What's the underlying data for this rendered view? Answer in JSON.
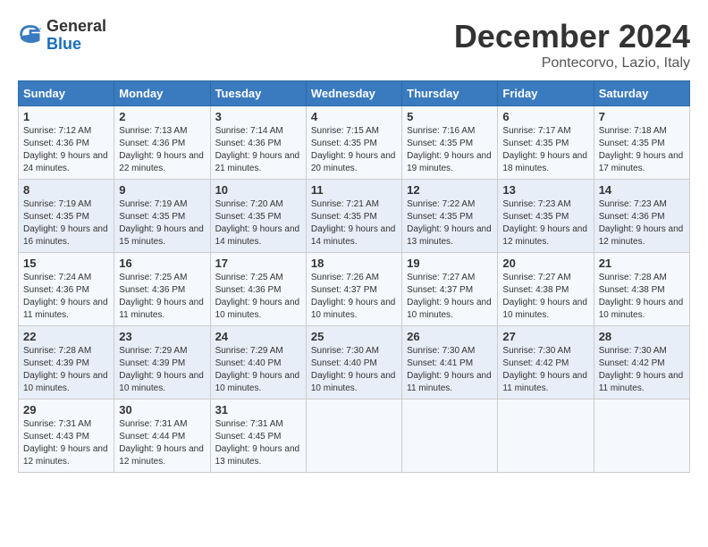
{
  "logo": {
    "general": "General",
    "blue": "Blue"
  },
  "title": "December 2024",
  "location": "Pontecorvo, Lazio, Italy",
  "headers": [
    "Sunday",
    "Monday",
    "Tuesday",
    "Wednesday",
    "Thursday",
    "Friday",
    "Saturday"
  ],
  "weeks": [
    [
      {
        "day": "1",
        "sunrise": "7:12 AM",
        "sunset": "4:36 PM",
        "daylight": "9 hours and 24 minutes."
      },
      {
        "day": "2",
        "sunrise": "7:13 AM",
        "sunset": "4:36 PM",
        "daylight": "9 hours and 22 minutes."
      },
      {
        "day": "3",
        "sunrise": "7:14 AM",
        "sunset": "4:36 PM",
        "daylight": "9 hours and 21 minutes."
      },
      {
        "day": "4",
        "sunrise": "7:15 AM",
        "sunset": "4:35 PM",
        "daylight": "9 hours and 20 minutes."
      },
      {
        "day": "5",
        "sunrise": "7:16 AM",
        "sunset": "4:35 PM",
        "daylight": "9 hours and 19 minutes."
      },
      {
        "day": "6",
        "sunrise": "7:17 AM",
        "sunset": "4:35 PM",
        "daylight": "9 hours and 18 minutes."
      },
      {
        "day": "7",
        "sunrise": "7:18 AM",
        "sunset": "4:35 PM",
        "daylight": "9 hours and 17 minutes."
      }
    ],
    [
      {
        "day": "8",
        "sunrise": "7:19 AM",
        "sunset": "4:35 PM",
        "daylight": "9 hours and 16 minutes."
      },
      {
        "day": "9",
        "sunrise": "7:19 AM",
        "sunset": "4:35 PM",
        "daylight": "9 hours and 15 minutes."
      },
      {
        "day": "10",
        "sunrise": "7:20 AM",
        "sunset": "4:35 PM",
        "daylight": "9 hours and 14 minutes."
      },
      {
        "day": "11",
        "sunrise": "7:21 AM",
        "sunset": "4:35 PM",
        "daylight": "9 hours and 14 minutes."
      },
      {
        "day": "12",
        "sunrise": "7:22 AM",
        "sunset": "4:35 PM",
        "daylight": "9 hours and 13 minutes."
      },
      {
        "day": "13",
        "sunrise": "7:23 AM",
        "sunset": "4:35 PM",
        "daylight": "9 hours and 12 minutes."
      },
      {
        "day": "14",
        "sunrise": "7:23 AM",
        "sunset": "4:36 PM",
        "daylight": "9 hours and 12 minutes."
      }
    ],
    [
      {
        "day": "15",
        "sunrise": "7:24 AM",
        "sunset": "4:36 PM",
        "daylight": "9 hours and 11 minutes."
      },
      {
        "day": "16",
        "sunrise": "7:25 AM",
        "sunset": "4:36 PM",
        "daylight": "9 hours and 11 minutes."
      },
      {
        "day": "17",
        "sunrise": "7:25 AM",
        "sunset": "4:36 PM",
        "daylight": "9 hours and 10 minutes."
      },
      {
        "day": "18",
        "sunrise": "7:26 AM",
        "sunset": "4:37 PM",
        "daylight": "9 hours and 10 minutes."
      },
      {
        "day": "19",
        "sunrise": "7:27 AM",
        "sunset": "4:37 PM",
        "daylight": "9 hours and 10 minutes."
      },
      {
        "day": "20",
        "sunrise": "7:27 AM",
        "sunset": "4:38 PM",
        "daylight": "9 hours and 10 minutes."
      },
      {
        "day": "21",
        "sunrise": "7:28 AM",
        "sunset": "4:38 PM",
        "daylight": "9 hours and 10 minutes."
      }
    ],
    [
      {
        "day": "22",
        "sunrise": "7:28 AM",
        "sunset": "4:39 PM",
        "daylight": "9 hours and 10 minutes."
      },
      {
        "day": "23",
        "sunrise": "7:29 AM",
        "sunset": "4:39 PM",
        "daylight": "9 hours and 10 minutes."
      },
      {
        "day": "24",
        "sunrise": "7:29 AM",
        "sunset": "4:40 PM",
        "daylight": "9 hours and 10 minutes."
      },
      {
        "day": "25",
        "sunrise": "7:30 AM",
        "sunset": "4:40 PM",
        "daylight": "9 hours and 10 minutes."
      },
      {
        "day": "26",
        "sunrise": "7:30 AM",
        "sunset": "4:41 PM",
        "daylight": "9 hours and 11 minutes."
      },
      {
        "day": "27",
        "sunrise": "7:30 AM",
        "sunset": "4:42 PM",
        "daylight": "9 hours and 11 minutes."
      },
      {
        "day": "28",
        "sunrise": "7:30 AM",
        "sunset": "4:42 PM",
        "daylight": "9 hours and 11 minutes."
      }
    ],
    [
      {
        "day": "29",
        "sunrise": "7:31 AM",
        "sunset": "4:43 PM",
        "daylight": "9 hours and 12 minutes."
      },
      {
        "day": "30",
        "sunrise": "7:31 AM",
        "sunset": "4:44 PM",
        "daylight": "9 hours and 12 minutes."
      },
      {
        "day": "31",
        "sunrise": "7:31 AM",
        "sunset": "4:45 PM",
        "daylight": "9 hours and 13 minutes."
      },
      null,
      null,
      null,
      null
    ]
  ]
}
